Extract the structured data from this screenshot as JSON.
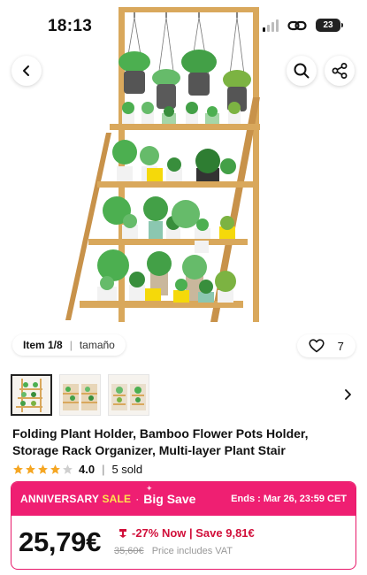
{
  "status": {
    "time": "18:13",
    "battery": "23"
  },
  "gallery": {
    "position": "Item 1/8",
    "variant_label": "tamaño",
    "likes": "7",
    "icons": {
      "back": "chevron-left-icon",
      "search": "search-icon",
      "share": "share-icon",
      "like": "heart-icon",
      "next": "chevron-right-icon"
    }
  },
  "product": {
    "title": "Folding Plant Holder, Bamboo Flower Pots Holder, Storage Rack Organizer, Multi-layer Plant Stair",
    "rating": "4.0",
    "stars": 4,
    "sold": "5 sold"
  },
  "promo": {
    "anniversary": "ANNIVERSARY",
    "sale": "SALE",
    "dot": "·",
    "big_save": "Big Save",
    "ends": "Ends : Mar 26, 23:59 CET",
    "price": "25,79€",
    "discount": "-27% Now | Save 9,81€",
    "old_price": "35,60€",
    "price_note": "Price includes VAT"
  },
  "colors": {
    "accent_pink": "#ef1f72",
    "discount_red": "#d10f3a",
    "star": "#f5a623",
    "bamboo": "#d9a85c"
  }
}
